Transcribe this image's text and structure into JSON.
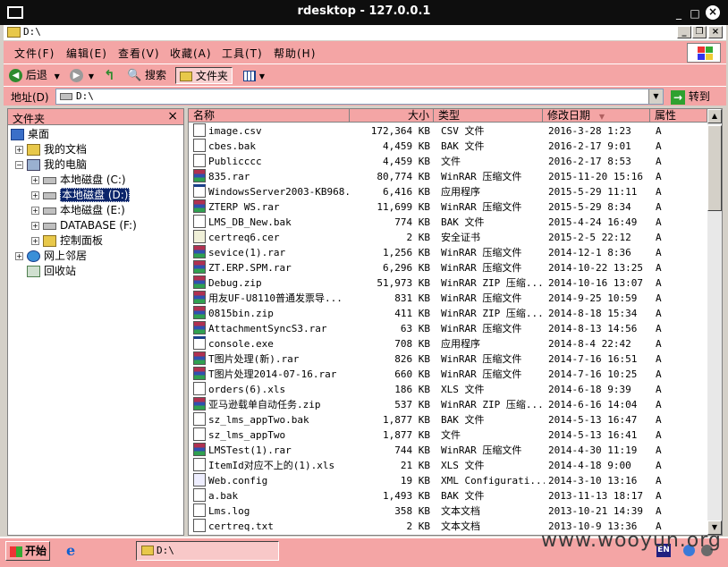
{
  "window": {
    "title": "rdesktop - 127.0.0.1"
  },
  "explorer": {
    "title": "D:\\",
    "address_label": "地址(D)",
    "address": "D:\\",
    "goto": "转到"
  },
  "menu": [
    "文件(F)",
    "编辑(E)",
    "查看(V)",
    "收藏(A)",
    "工具(T)",
    "帮助(H)"
  ],
  "toolbar": {
    "back": "后退",
    "search": "搜索",
    "folders": "文件夹"
  },
  "folders_pane": {
    "title": "文件夹"
  },
  "tree": [
    {
      "label": "桌面"
    },
    {
      "label": "我的文档"
    },
    {
      "label": "我的电脑"
    },
    {
      "label": "本地磁盘 (C:)"
    },
    {
      "label": "本地磁盘 (D:)"
    },
    {
      "label": "本地磁盘 (E:)"
    },
    {
      "label": "DATABASE (F:)"
    },
    {
      "label": "控制面板"
    },
    {
      "label": "网上邻居"
    },
    {
      "label": "回收站"
    }
  ],
  "columns": {
    "name": "名称",
    "size": "大小",
    "type": "类型",
    "date": "修改日期",
    "attr": "属性"
  },
  "files": [
    {
      "name": "image.csv",
      "size": "172,364 KB",
      "type": "CSV 文件",
      "date": "2016-3-28 1:23",
      "attr": "A",
      "icon": "doc"
    },
    {
      "name": "cbes.bak",
      "size": "4,459 KB",
      "type": "BAK 文件",
      "date": "2016-2-17 9:01",
      "attr": "A",
      "icon": "doc"
    },
    {
      "name": "Publicccc",
      "size": "4,459 KB",
      "type": "文件",
      "date": "2016-2-17 8:53",
      "attr": "A",
      "icon": "doc"
    },
    {
      "name": "835.rar",
      "size": "80,774 KB",
      "type": "WinRAR 压缩文件",
      "date": "2015-11-20 15:16",
      "attr": "A",
      "icon": "rar"
    },
    {
      "name": "WindowsServer2003-KB968...",
      "size": "6,416 KB",
      "type": "应用程序",
      "date": "2015-5-29 11:11",
      "attr": "A",
      "icon": "exe"
    },
    {
      "name": "ZTERP WS.rar",
      "size": "11,699 KB",
      "type": "WinRAR 压缩文件",
      "date": "2015-5-29 8:34",
      "attr": "A",
      "icon": "rar"
    },
    {
      "name": "LMS_DB_New.bak",
      "size": "774 KB",
      "type": "BAK 文件",
      "date": "2015-4-24 16:49",
      "attr": "A",
      "icon": "doc"
    },
    {
      "name": "certreq6.cer",
      "size": "2 KB",
      "type": "安全证书",
      "date": "2015-2-5 22:12",
      "attr": "A",
      "icon": "cer"
    },
    {
      "name": "sevice(1).rar",
      "size": "1,256 KB",
      "type": "WinRAR 压缩文件",
      "date": "2014-12-1 8:36",
      "attr": "A",
      "icon": "rar"
    },
    {
      "name": "ZT.ERP.SPM.rar",
      "size": "6,296 KB",
      "type": "WinRAR 压缩文件",
      "date": "2014-10-22 13:25",
      "attr": "A",
      "icon": "rar"
    },
    {
      "name": "Debug.zip",
      "size": "51,973 KB",
      "type": "WinRAR ZIP 压缩...",
      "date": "2014-10-16 13:07",
      "attr": "A",
      "icon": "rar"
    },
    {
      "name": "用友UF-U8110普通发票导...",
      "size": "831 KB",
      "type": "WinRAR 压缩文件",
      "date": "2014-9-25 10:59",
      "attr": "A",
      "icon": "rar"
    },
    {
      "name": "0815bin.zip",
      "size": "411 KB",
      "type": "WinRAR ZIP 压缩...",
      "date": "2014-8-18 15:34",
      "attr": "A",
      "icon": "rar"
    },
    {
      "name": "AttachmentSyncS3.rar",
      "size": "63 KB",
      "type": "WinRAR 压缩文件",
      "date": "2014-8-13 14:56",
      "attr": "A",
      "icon": "rar"
    },
    {
      "name": "console.exe",
      "size": "708 KB",
      "type": "应用程序",
      "date": "2014-8-4 22:42",
      "attr": "A",
      "icon": "exe"
    },
    {
      "name": "T图片处理(新).rar",
      "size": "826 KB",
      "type": "WinRAR 压缩文件",
      "date": "2014-7-16 16:51",
      "attr": "A",
      "icon": "rar"
    },
    {
      "name": "T图片处理2014-07-16.rar",
      "size": "660 KB",
      "type": "WinRAR 压缩文件",
      "date": "2014-7-16 10:25",
      "attr": "A",
      "icon": "rar"
    },
    {
      "name": "orders(6).xls",
      "size": "186 KB",
      "type": "XLS 文件",
      "date": "2014-6-18 9:39",
      "attr": "A",
      "icon": "doc"
    },
    {
      "name": "亚马逊载单自动任务.zip",
      "size": "537 KB",
      "type": "WinRAR ZIP 压缩...",
      "date": "2014-6-16 14:04",
      "attr": "A",
      "icon": "rar"
    },
    {
      "name": "sz_lms_appTwo.bak",
      "size": "1,877 KB",
      "type": "BAK 文件",
      "date": "2014-5-13 16:47",
      "attr": "A",
      "icon": "doc"
    },
    {
      "name": "sz_lms_appTwo",
      "size": "1,877 KB",
      "type": "文件",
      "date": "2014-5-13 16:41",
      "attr": "A",
      "icon": "doc"
    },
    {
      "name": "LMSTest(1).rar",
      "size": "744 KB",
      "type": "WinRAR 压缩文件",
      "date": "2014-4-30 11:19",
      "attr": "A",
      "icon": "rar"
    },
    {
      "name": "ItemId对应不上的(1).xls",
      "size": "21 KB",
      "type": "XLS 文件",
      "date": "2014-4-18 9:00",
      "attr": "A",
      "icon": "doc"
    },
    {
      "name": "Web.config",
      "size": "19 KB",
      "type": "XML Configurati...",
      "date": "2014-3-10 13:16",
      "attr": "A",
      "icon": "cfg"
    },
    {
      "name": "a.bak",
      "size": "1,493 KB",
      "type": "BAK 文件",
      "date": "2013-11-13 18:17",
      "attr": "A",
      "icon": "doc"
    },
    {
      "name": "Lms.log",
      "size": "358 KB",
      "type": "文本文档",
      "date": "2013-10-21 14:39",
      "attr": "A",
      "icon": "txt"
    },
    {
      "name": "certreq.txt",
      "size": "2 KB",
      "type": "文本文档",
      "date": "2013-10-9 13:36",
      "attr": "A",
      "icon": "txt"
    }
  ],
  "taskbar": {
    "start": "开始",
    "task": "D:\\",
    "lang": "EN"
  },
  "watermark": "www.wooyun.org",
  "colors": {
    "chrome_pink": "#f4a5a5",
    "titlebar": "#0e0e0e",
    "selection": "#0a246a"
  }
}
